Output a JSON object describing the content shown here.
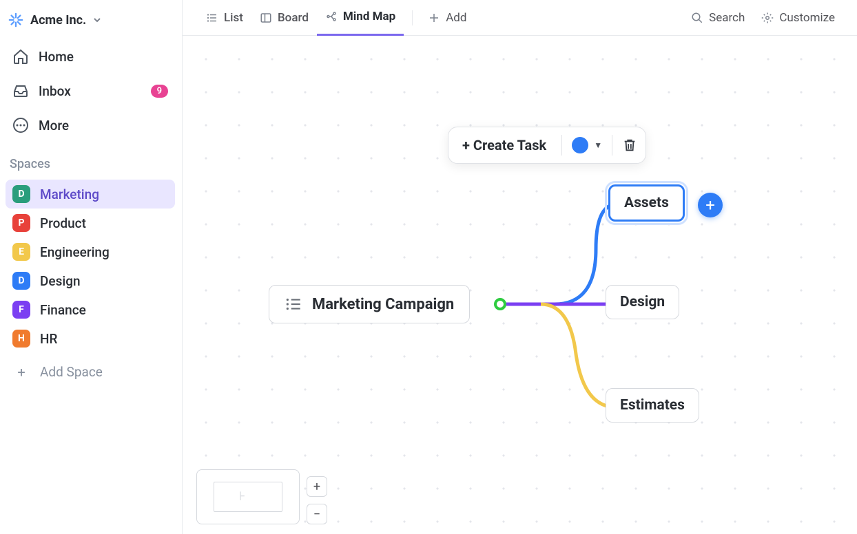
{
  "workspace": {
    "name": "Acme Inc."
  },
  "sidebar": {
    "home": "Home",
    "inbox": "Inbox",
    "inbox_count": "9",
    "more": "More",
    "section": "Spaces",
    "add_space": "Add Space",
    "spaces": [
      {
        "letter": "D",
        "label": "Marketing",
        "bg": "#2a9d7c",
        "active": true
      },
      {
        "letter": "P",
        "label": "Product",
        "bg": "#e8413a",
        "active": false
      },
      {
        "letter": "E",
        "label": "Engineering",
        "bg": "#f2c84b",
        "active": false
      },
      {
        "letter": "D",
        "label": "Design",
        "bg": "#2e7cf6",
        "active": false
      },
      {
        "letter": "F",
        "label": "Finance",
        "bg": "#7b3ff2",
        "active": false
      },
      {
        "letter": "H",
        "label": "HR",
        "bg": "#f07b2e",
        "active": false
      }
    ]
  },
  "topbar": {
    "views": [
      {
        "label": "List",
        "active": false
      },
      {
        "label": "Board",
        "active": false
      },
      {
        "label": "Mind Map",
        "active": true
      }
    ],
    "add": "Add",
    "search": "Search",
    "customize": "Customize"
  },
  "mindmap": {
    "root": "Marketing Campaign",
    "children": [
      {
        "label": "Assets",
        "color": "#2e7cf6",
        "selected": true
      },
      {
        "label": "Design",
        "color": "#7b3ff2",
        "selected": false
      },
      {
        "label": "Estimates",
        "color": "#f2c84b",
        "selected": false
      }
    ],
    "toolbar": {
      "create": "+ Create Task",
      "color": "#2e7cf6"
    }
  }
}
